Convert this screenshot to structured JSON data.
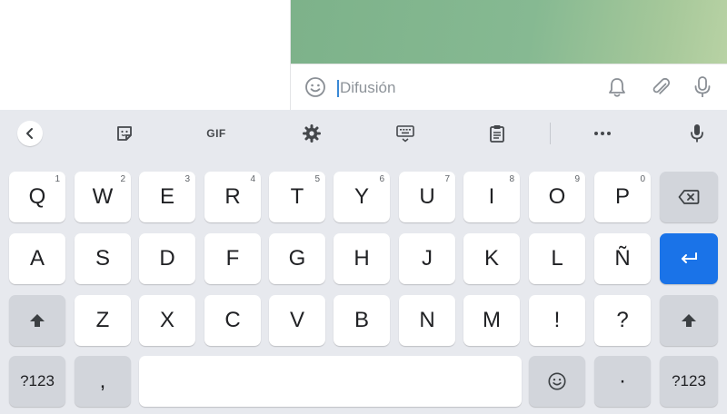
{
  "composer": {
    "placeholder": "Difusión",
    "icons": {
      "emoji": "emoji-icon",
      "bell": "bell-icon",
      "attach": "paperclip-icon",
      "mic": "microphone-icon"
    }
  },
  "toolbar": {
    "gif_label": "GIF",
    "more_label": "•••",
    "icons": [
      "back-chevron-icon",
      "sticker-icon",
      "gear-icon",
      "keyboard-icon",
      "clipboard-icon",
      "more-icon",
      "microphone-icon"
    ]
  },
  "keys": {
    "row1": [
      {
        "label": "Q",
        "hint": "1"
      },
      {
        "label": "W",
        "hint": "2"
      },
      {
        "label": "E",
        "hint": "3"
      },
      {
        "label": "R",
        "hint": "4"
      },
      {
        "label": "T",
        "hint": "5"
      },
      {
        "label": "Y",
        "hint": "6"
      },
      {
        "label": "U",
        "hint": "7"
      },
      {
        "label": "I",
        "hint": "8"
      },
      {
        "label": "O",
        "hint": "9"
      },
      {
        "label": "P",
        "hint": "0"
      }
    ],
    "row2": [
      "A",
      "S",
      "D",
      "F",
      "G",
      "H",
      "J",
      "K",
      "L",
      "Ñ"
    ],
    "row3": [
      "Z",
      "X",
      "C",
      "V",
      "B",
      "N",
      "M",
      "!",
      "?"
    ],
    "symbols_label": "?123",
    "comma_label": ",",
    "period_label": "·",
    "symbols_right_label": "?123"
  },
  "colors": {
    "keyboard_bg": "#e7e9ee",
    "key_bg": "#ffffff",
    "function_key_bg": "#d2d5db",
    "enter_key_bg": "#1a73e8"
  }
}
